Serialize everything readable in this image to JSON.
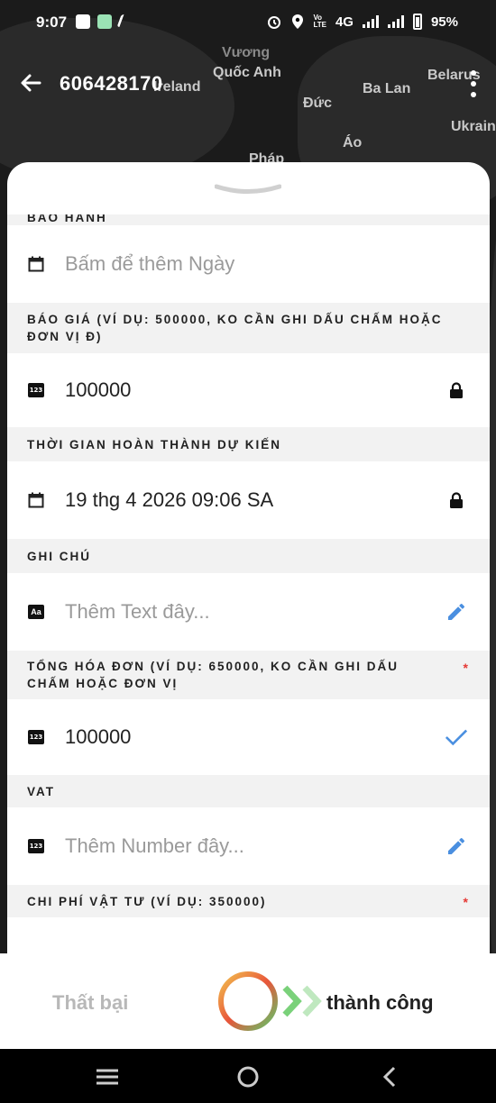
{
  "status_bar": {
    "time": "9:07",
    "network_label": "4G",
    "battery": "95%"
  },
  "header": {
    "title": "606428170"
  },
  "map_labels": [
    "Vương",
    "Quốc Anh",
    "Ireland",
    "Ba Lan",
    "Belarus",
    "Đức",
    "Áo",
    "Pháp",
    "Ukrain"
  ],
  "form": {
    "warranty": {
      "label": "BẢO HÀNH",
      "placeholder": "Bấm để thêm Ngày"
    },
    "quote": {
      "label": "BÁO GIÁ (VÍ DỤ: 500000, KO CẦN GHI DẤU CHẤM HOẶC ĐƠN VỊ Đ)",
      "value": "100000"
    },
    "eta": {
      "label": "THỜI GIAN HOÀN THÀNH DỰ KIẾN",
      "value": "19 thg 4 2026 09:06 SA"
    },
    "note": {
      "label": "GHI CHÚ",
      "placeholder": "Thêm Text đây..."
    },
    "invoice_total": {
      "label": "TỔNG HÓA ĐƠN (VÍ DỤ: 650000, KO CẦN GHI DẤU CHẤM HOẶC ĐƠN VỊ",
      "required_mark": "*",
      "value": "100000"
    },
    "vat": {
      "label": "VAT",
      "placeholder": "Thêm Number đây..."
    },
    "material_cost": {
      "label": "CHI PHÍ VẬT TƯ (VÍ DỤ: 350000)",
      "required_mark": "*"
    }
  },
  "swipe_bar": {
    "fail_label": "Thất bại",
    "success_label": "thành công"
  },
  "icons": {
    "num_icon_text": "123",
    "text_icon_text": "Aa"
  },
  "colors": {
    "accent_blue": "#4a8fe0",
    "required_red": "#e53935",
    "chevron_green": "#7ad17a"
  }
}
